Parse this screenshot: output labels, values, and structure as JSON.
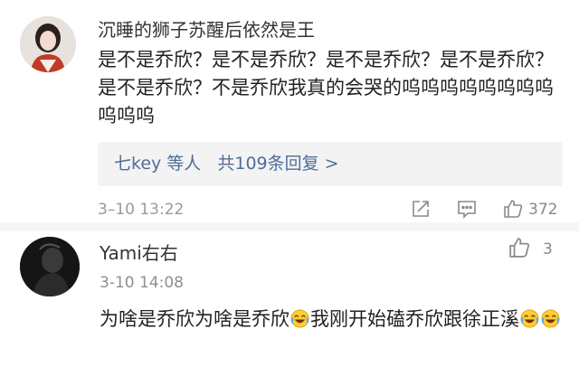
{
  "comment1": {
    "username": "沉睡的狮子苏醒后依然是王",
    "text": "是不是乔欣？是不是乔欣？是不是乔欣？是不是乔欣？是不是乔欣？不是乔欣我真的会哭的呜呜呜呜呜呜呜呜呜呜呜",
    "replies": {
      "users": "七key 等人",
      "count": "共109条回复 >"
    },
    "time": "3–10 13:22",
    "actions": [
      "share-icon",
      "comment-icon",
      "like-icon"
    ],
    "like_count": "372"
  },
  "comment2": {
    "username": "Yami右右",
    "time": "3-10 14:08",
    "like_count": "3",
    "text_part1": "为啥是乔欣为啥是乔欣",
    "text_part2": "我刚开始磕乔欣跟徐正溪",
    "emojis": [
      "laugh-cry-emoji",
      "laugh-cry-emoji",
      "laugh-cry-emoji"
    ]
  },
  "colors": {
    "link": "#506d98",
    "meta": "#9a9a9a",
    "reply_bg": "#f3f3f3",
    "divider": "#f6f6f6"
  }
}
